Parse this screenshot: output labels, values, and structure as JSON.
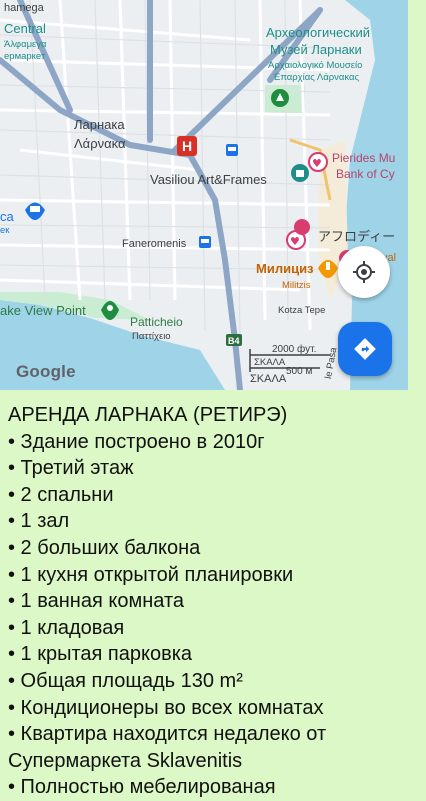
{
  "map": {
    "labels": {
      "hamega": "hamega",
      "central": "Central",
      "alfamega": "Άλφαμεγα",
      "supermarket": "ермаркет",
      "larnaka_ru": "Ларнака",
      "larnaka_gr": "Λάρνακα",
      "museum_ru_1": "Археологический",
      "museum_ru_2": "Музей Ларнаки",
      "museum_gr_1": "Αρχαιολογικό Μουσείο",
      "museum_gr_2": "Επαρχίας Λάρνακας",
      "vasiliou": "Vasiliou Art&Frames",
      "pierides_1": "Pierides Mu",
      "pierides_2": "Bank of Cy",
      "ca": "ca",
      "ek": "ек",
      "faneromenis": "Faneromenis",
      "afrodite": "アフロディー",
      "val": "val",
      "militsiya": "Милициз",
      "militzis": "Militzis",
      "lake_view": "ake View Point",
      "kotza": "Kotza Tepe",
      "patticheio_en": "Patticheio",
      "patticheio_gr": "Παττίχειο",
      "b4": "B4",
      "skala_1": "ΣΚΑΛΑ",
      "skala_2": "ΣΚΑΛΑ",
      "pasa": "le Pasa",
      "scale_ft": "2000 фут.",
      "scale_m": "500 м"
    },
    "google": "Google",
    "icons": [
      "hospital-icon",
      "bus-icon",
      "shopping-icon",
      "heart-icon",
      "fork-knife-icon",
      "park-icon",
      "my-location-icon",
      "directions-icon"
    ],
    "colors": {
      "water": "#9fd4e8",
      "land": "#eceff1",
      "road_main": "#8ea6c6",
      "green_area": "#c9ecd3",
      "fab_blue": "#1a73e8"
    }
  },
  "post": {
    "title": "АРЕНДА ЛАРНАКА  (РЕТИРЭ)",
    "items": [
      "• Здание построено в 2010г",
      "• Третий этаж",
      "• 2 спальни",
      "• 1 зал",
      "• 2  больших балкона",
      "• 1 кухня открытой планировки",
      "• 1 ванная комната",
      "• 1 кладовая",
      "• 1 крытая парковка",
      "• Общая площадь 130 m²",
      "• Кондиционеры во всех комнатах",
      "• Квартира находится недалеко от",
      "Супермаркета Sklavenitis",
      "• Полностью мебелированая"
    ]
  }
}
